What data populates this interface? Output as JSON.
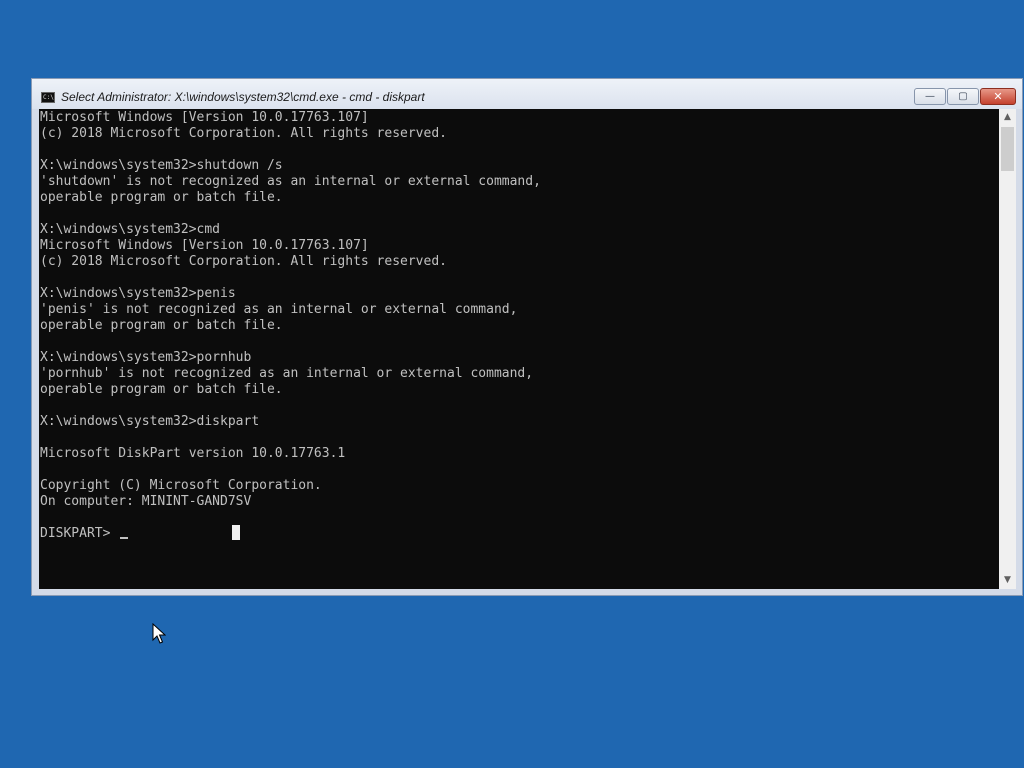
{
  "window": {
    "title": "Select Administrator: X:\\windows\\system32\\cmd.exe - cmd - diskpart",
    "minimize_glyph": "—",
    "maximize_glyph": "▢",
    "close_glyph": "✕",
    "app_icon_text": "C:\\"
  },
  "console": {
    "lines": [
      "Microsoft Windows [Version 10.0.17763.107]",
      "(c) 2018 Microsoft Corporation. All rights reserved.",
      "",
      "X:\\windows\\system32>shutdown /s",
      "'shutdown' is not recognized as an internal or external command,",
      "operable program or batch file.",
      "",
      "X:\\windows\\system32>cmd",
      "Microsoft Windows [Version 10.0.17763.107]",
      "(c) 2018 Microsoft Corporation. All rights reserved.",
      "",
      "X:\\windows\\system32>penis",
      "'penis' is not recognized as an internal or external command,",
      "operable program or batch file.",
      "",
      "X:\\windows\\system32>pornhub",
      "'pornhub' is not recognized as an internal or external command,",
      "operable program or batch file.",
      "",
      "X:\\windows\\system32>diskpart",
      "",
      "Microsoft DiskPart version 10.0.17763.1",
      "",
      "Copyright (C) Microsoft Corporation.",
      "On computer: MININT-GAND7SV",
      ""
    ],
    "prompt": "DISKPART> "
  },
  "scrollbar": {
    "up_glyph": "▲",
    "down_glyph": "▼"
  },
  "colors": {
    "desktop": "#1f67b1",
    "console_bg": "#0c0c0c",
    "console_fg": "#c0c0c0"
  },
  "icons": [
    "cmd-app-icon",
    "minimize-icon",
    "maximize-icon",
    "close-icon",
    "scroll-up-icon",
    "scroll-down-icon",
    "mouse-pointer-icon"
  ]
}
